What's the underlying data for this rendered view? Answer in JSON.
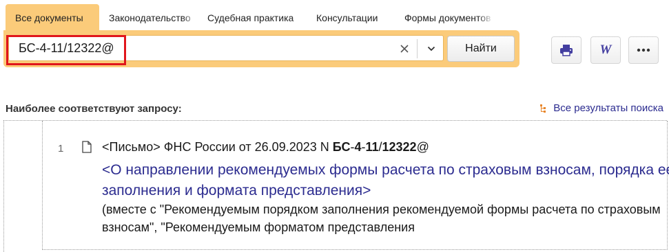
{
  "tabs": [
    {
      "label": "Все документы",
      "active": true
    },
    {
      "label": "Законодательство"
    },
    {
      "label": "Судебная практика"
    },
    {
      "label": "Консультации"
    },
    {
      "label": "Формы документов"
    }
  ],
  "search": {
    "value": "БС-4-11/12322@",
    "find_label": "Найти"
  },
  "toolbar": {
    "print_icon": "printer-icon",
    "word_glyph": "W",
    "more_glyph": "•••"
  },
  "results_header": {
    "title": "Наиболее соответствуют запросу:",
    "all_results": "Все результаты поиска"
  },
  "results": [
    {
      "num": "1",
      "prefix": "<Письмо> ФНС России от 26.09.2023 N ",
      "bold_parts": [
        "БС",
        "4",
        "11",
        "12322"
      ],
      "seps": [
        "-",
        "-",
        "/"
      ],
      "suffix": "@",
      "title": "<О направлении рекомендуемых формы расчета по страховым взносам, порядка ее заполнения и формата представления>",
      "description": "(вместе с \"Рекомендуемым порядком заполнения рекомендуемой формы расчета по страховым взносам\", \"Рекомендуемым форматом представления"
    }
  ],
  "colors": {
    "accent": "#fbcb7a",
    "highlight": "#e0151b",
    "link": "#2b2b8f"
  }
}
